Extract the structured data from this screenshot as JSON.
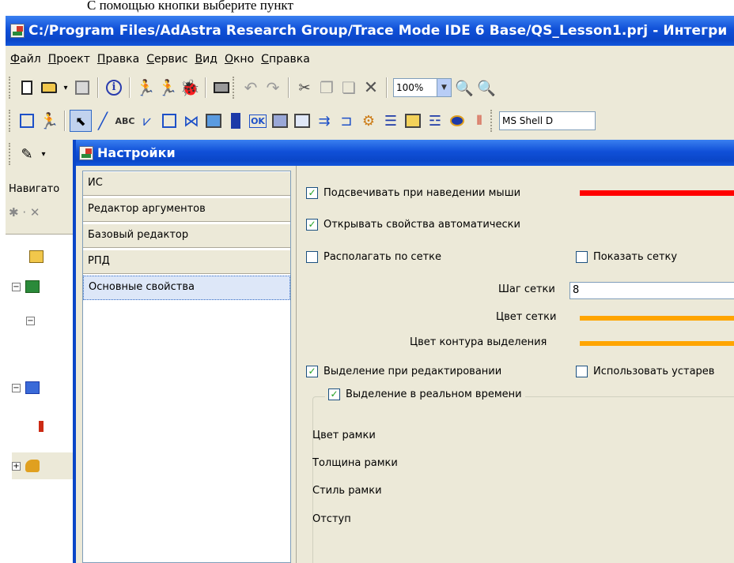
{
  "caption": "С помощью кнопки  выберите пункт",
  "window": {
    "title": "C:/Program Files/AdAstra Research Group/Trace Mode IDE 6 Base/QS_Lesson1.prj - Интегри"
  },
  "menu": [
    {
      "u": "Ф",
      "rest": "айл"
    },
    {
      "u": "П",
      "rest": "роект"
    },
    {
      "u": "П",
      "rest": "равка"
    },
    {
      "u": "С",
      "rest": "ервис"
    },
    {
      "u": "В",
      "rest": "ид"
    },
    {
      "u": "О",
      "rest": "кно"
    },
    {
      "u": "С",
      "rest": "правка"
    }
  ],
  "toolbar": {
    "zoom_value": "100%",
    "font_value": "MS Shell D",
    "abc_label": "ABC",
    "ok_label": "OK"
  },
  "navigator": {
    "label": "Навигато",
    "colors": {
      "folder": "#f1c74b",
      "tree_red": "#cc2a14"
    }
  },
  "dialog": {
    "title": "Настройки",
    "categories": [
      {
        "label": "ИС"
      },
      {
        "label": "Редактор аргументов"
      },
      {
        "label": "Базовый редактор"
      },
      {
        "label": "РПД"
      },
      {
        "label": "Основные свойства"
      }
    ],
    "selected_category": "Основные свойства",
    "options": {
      "highlight_on_hover": {
        "label": "Подсвечивать при наведении мыши",
        "checked": true,
        "color": "#ff0000"
      },
      "open_props_auto": {
        "label": "Открывать свойства автоматически",
        "checked": true
      },
      "snap_to_grid": {
        "label": "Располагать по сетке",
        "checked": false
      },
      "show_grid": {
        "label": "Показать сетку",
        "checked": false
      },
      "grid_step_label": "Шаг сетки",
      "grid_step_value": "8",
      "grid_color_label": "Цвет сетки",
      "grid_color": "#ffa500",
      "selection_color_label": "Цвет контура выделения",
      "selection_color": "#ffa500",
      "select_on_edit": {
        "label": "Выделение при редактировании",
        "checked": true
      },
      "use_legacy": {
        "label": "Использовать устарев",
        "checked": false
      },
      "realtime_group": {
        "label": "Выделение в реальном времени",
        "checked": true
      },
      "frame_color_label": "Цвет рамки",
      "frame_width_label": "Толщина рамки",
      "frame_style_label": "Стиль рамки",
      "indent_label": "Отступ"
    }
  }
}
